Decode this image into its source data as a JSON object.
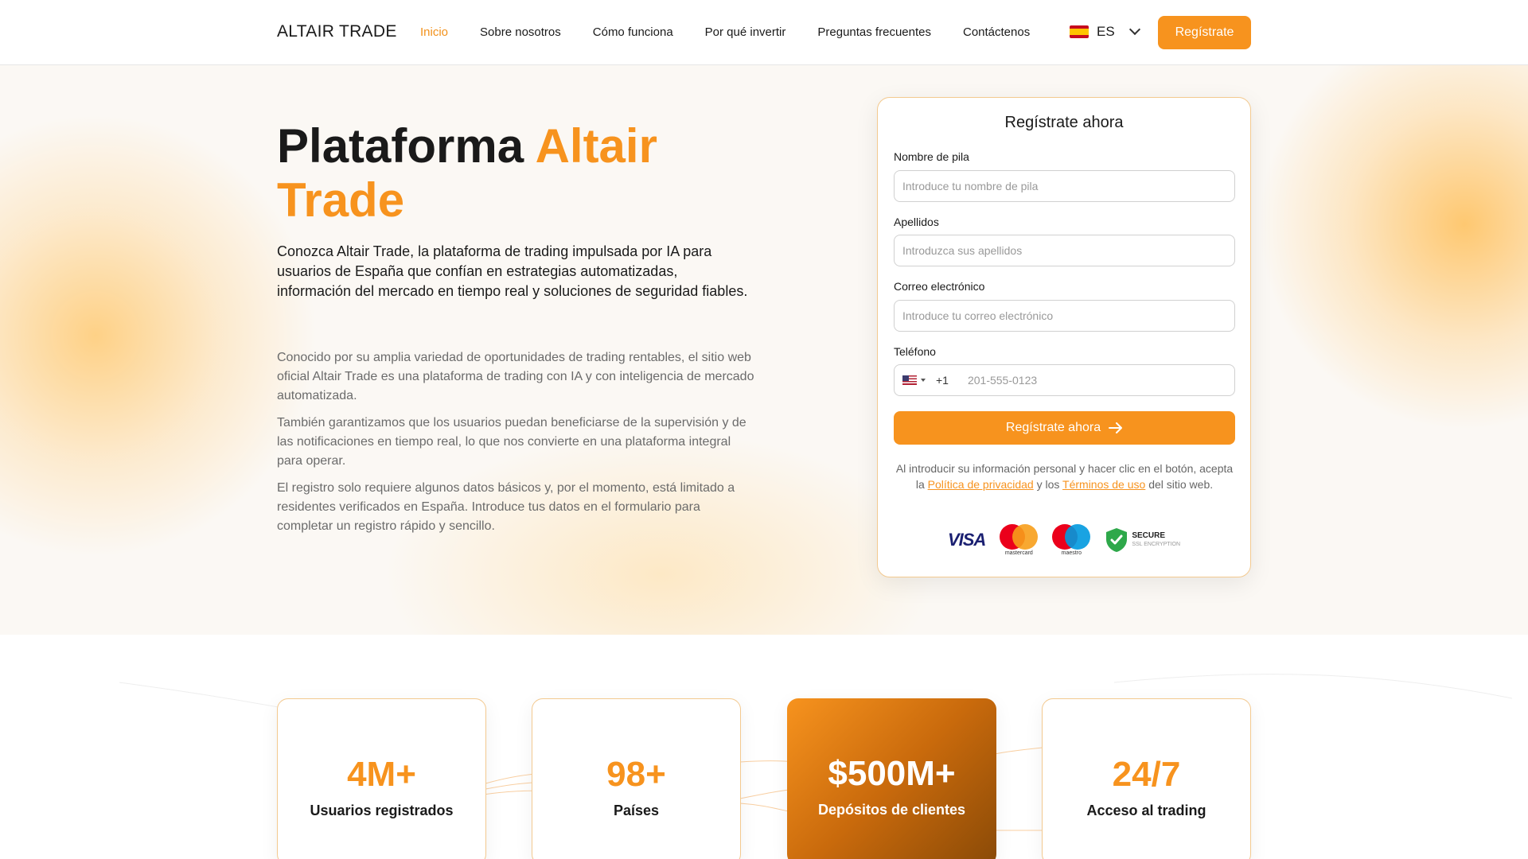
{
  "header": {
    "logo": "ALTAIR TRADE",
    "nav": [
      "Inicio",
      "Sobre nosotros",
      "Cómo funciona",
      "Por qué invertir",
      "Preguntas frecuentes",
      "Contáctenos"
    ],
    "language": "ES",
    "register_label": "Regístrate"
  },
  "hero": {
    "title_part1": "Plataforma ",
    "title_accent1": "Altair",
    "title_accent2": "Trade",
    "lead": "Conozca Altair Trade, la plataforma de trading impulsada por IA para usuarios de España que confían en estrategias automatizadas, información del mercado en tiempo real y soluciones de seguridad fiables.",
    "paragraphs": [
      "Conocido por su amplia variedad de oportunidades de trading rentables, el sitio web oficial Altair Trade es una plataforma de trading con IA y con inteligencia de mercado automatizada.",
      "También garantizamos que los usuarios puedan beneficiarse de la supervisión y de las notificaciones en tiempo real, lo que nos convierte en una plataforma integral para operar.",
      "El registro solo requiere algunos datos básicos y, por el momento, está limitado a residentes verificados en España. Introduce tus datos en el formulario para completar un registro rápido y sencillo."
    ]
  },
  "form": {
    "title": "Regístrate ahora",
    "first_name_label": "Nombre de pila",
    "first_name_placeholder": "Introduce tu nombre de pila",
    "last_name_label": "Apellidos",
    "last_name_placeholder": "Introduzca sus apellidos",
    "email_label": "Correo electrónico",
    "email_placeholder": "Introduce tu correo electrónico",
    "phone_label": "Teléfono",
    "phone_code": "+1",
    "phone_placeholder": "201-555-0123",
    "submit_label": "Regístrate ahora",
    "legal_before": "Al introducir su información personal y hacer clic en el botón, acepta la ",
    "privacy_link": "Política de privacidad",
    "legal_mid": " y los ",
    "terms_link": "Términos de uso",
    "legal_after": " del sitio web.",
    "payment_logos": {
      "visa": "VISA",
      "mastercard": "mastercard",
      "maestro": "maestro",
      "secure_title": "SECURE",
      "secure_sub": "SSL ENCRYPTION"
    }
  },
  "stats": [
    {
      "value": "4M+",
      "label": "Usuarios registrados"
    },
    {
      "value": "98+",
      "label": "Países"
    },
    {
      "value": "$500M+",
      "label": "Depósitos de clientes"
    },
    {
      "value": "24/7",
      "label": "Acceso al trading"
    }
  ],
  "colors": {
    "accent": "#f7931e",
    "text": "#1a1a1a",
    "muted": "#6b6b6b"
  }
}
